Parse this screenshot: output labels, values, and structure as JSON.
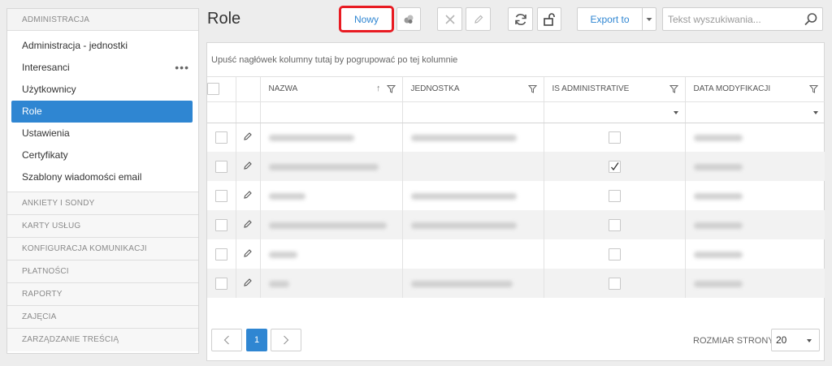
{
  "sidebar": {
    "top_section": "ADMINISTRACJA",
    "items": [
      {
        "label": "Administracja - jednostki"
      },
      {
        "label": "Interesanci",
        "more": "•••"
      },
      {
        "label": "Użytkownicy"
      },
      {
        "label": "Role"
      },
      {
        "label": "Ustawienia"
      },
      {
        "label": "Certyfikaty"
      },
      {
        "label": "Szablony wiadomości email"
      }
    ],
    "sections": [
      "ANKIETY I SONDY",
      "KARTY USŁUG",
      "KONFIGURACJA KOMUNIKACJI",
      "PŁATNOŚCI",
      "RAPORTY",
      "ZAJĘCIA",
      "ZARZĄDZANIE TREŚCIĄ"
    ]
  },
  "page": {
    "title": "Role"
  },
  "toolbar": {
    "new_label": "Nowy",
    "export_label": "Export to",
    "search_placeholder": "Tekst wyszukiwania..."
  },
  "grid": {
    "group_hint": "Upuść nagłówek kolumny tutaj by pogrupować po tej kolumnie",
    "columns": [
      "NAZWA",
      "JEDNOSTKA",
      "IS ADMINISTRATIVE",
      "DATA MODYFIKACJI"
    ],
    "rows": [
      {
        "is_admin": false
      },
      {
        "is_admin": true
      },
      {
        "is_admin": false
      },
      {
        "is_admin": false
      },
      {
        "is_admin": false
      },
      {
        "is_admin": false
      }
    ]
  },
  "pager": {
    "current_page": "1",
    "page_size_label": "ROZMIAR STRONY",
    "page_size": "20"
  },
  "colors": {
    "accent": "#2f86d2",
    "highlight": "#e81b22"
  }
}
